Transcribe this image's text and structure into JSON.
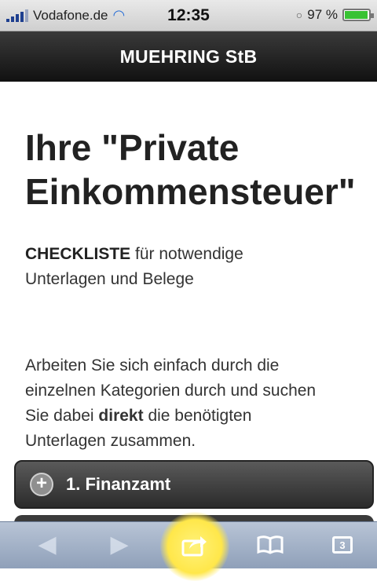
{
  "status": {
    "carrier": "Vodafone.de",
    "time": "12:35",
    "battery_text": "97 %"
  },
  "nav": {
    "title": "MUEHRING StB"
  },
  "page": {
    "headline_line1": "Ihre \"Private",
    "headline_line2": "Einkommensteuer\"",
    "checklist_bold": "CHECKLISTE",
    "checklist_rest": "für notwendige",
    "checklist_line2": "Unterlagen und Belege",
    "intro_1": "Arbeiten Sie sich einfach durch die",
    "intro_2": "einzelnen Kategorien durch und suchen",
    "intro_3a": "Sie dabei",
    "intro_3b": "direkt",
    "intro_3c": "die benötigten",
    "intro_4": "Unterlagen zusammen."
  },
  "categories": [
    {
      "label": "1. Finanzamt"
    }
  ],
  "toolbar": {
    "tabs_count": "3",
    "icons": [
      "back-icon",
      "forward-icon",
      "share-icon",
      "bookmarks-icon",
      "tabs-icon"
    ]
  },
  "colors": {
    "title_bar": "#1c1c1c",
    "toolbar": "#9aabc3",
    "highlight": "#ffe74a",
    "battery": "#38c233"
  }
}
